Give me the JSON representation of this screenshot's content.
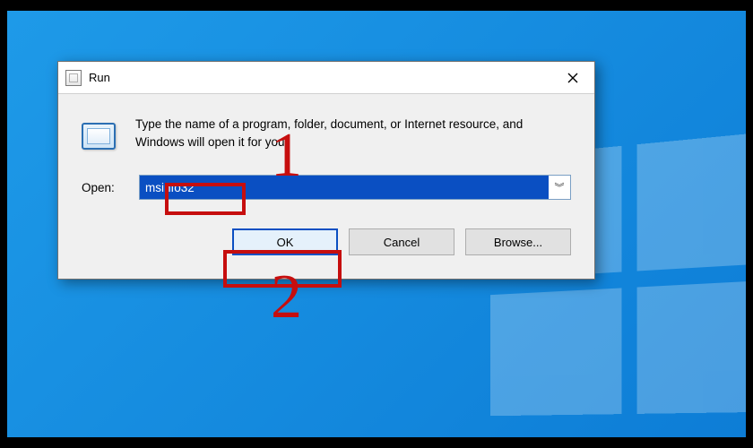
{
  "dialog": {
    "title": "Run",
    "description": "Type the name of a program, folder, document, or Internet resource, and Windows will open it for you.",
    "open_label": "Open:",
    "input_value": "msinfo32",
    "buttons": {
      "ok": "OK",
      "cancel": "Cancel",
      "browse": "Browse..."
    }
  },
  "annotations": {
    "step1": "1",
    "step2": "2"
  }
}
